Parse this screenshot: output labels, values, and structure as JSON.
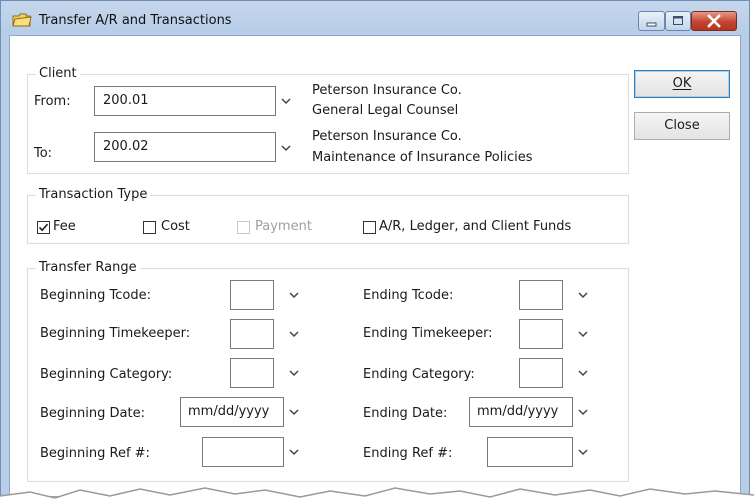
{
  "window": {
    "title": "Transfer A/R and Transactions"
  },
  "buttons": {
    "ok": "OK",
    "close": "Close"
  },
  "client": {
    "group_label": "Client",
    "from_label": "From:",
    "from_value": "200.01",
    "from_name": "Peterson Insurance Co.",
    "from_matter": "General Legal Counsel",
    "to_label": "To:",
    "to_value": "200.02",
    "to_name": "Peterson Insurance Co.",
    "to_matter": "Maintenance of Insurance Policies"
  },
  "transaction_type": {
    "group_label": "Transaction Type",
    "options": [
      {
        "label": "Fee",
        "checked": true,
        "disabled": false
      },
      {
        "label": "Cost",
        "checked": false,
        "disabled": false
      },
      {
        "label": "Payment",
        "checked": false,
        "disabled": true
      },
      {
        "label": "A/R,  Ledger, and Client Funds",
        "checked": false,
        "disabled": false
      }
    ]
  },
  "transfer_range": {
    "group_label": "Transfer Range",
    "beginning_tcode": "Beginning Tcode:",
    "ending_tcode": "Ending Tcode:",
    "beginning_timekeeper": "Beginning Timekeeper:",
    "ending_timekeeper": "Ending Timekeeper:",
    "beginning_category": "Beginning Category:",
    "ending_category": "Ending Category:",
    "beginning_date": "Beginning Date:",
    "ending_date": "Ending Date:",
    "date_placeholder": "mm/dd/yyyy",
    "beginning_ref": "Beginning Ref #:",
    "ending_ref": "Ending Ref #:"
  },
  "colors": {
    "title_bar": "#b8cde8",
    "close_button": "#c24530",
    "default_button_border": "#3c7fb1"
  }
}
